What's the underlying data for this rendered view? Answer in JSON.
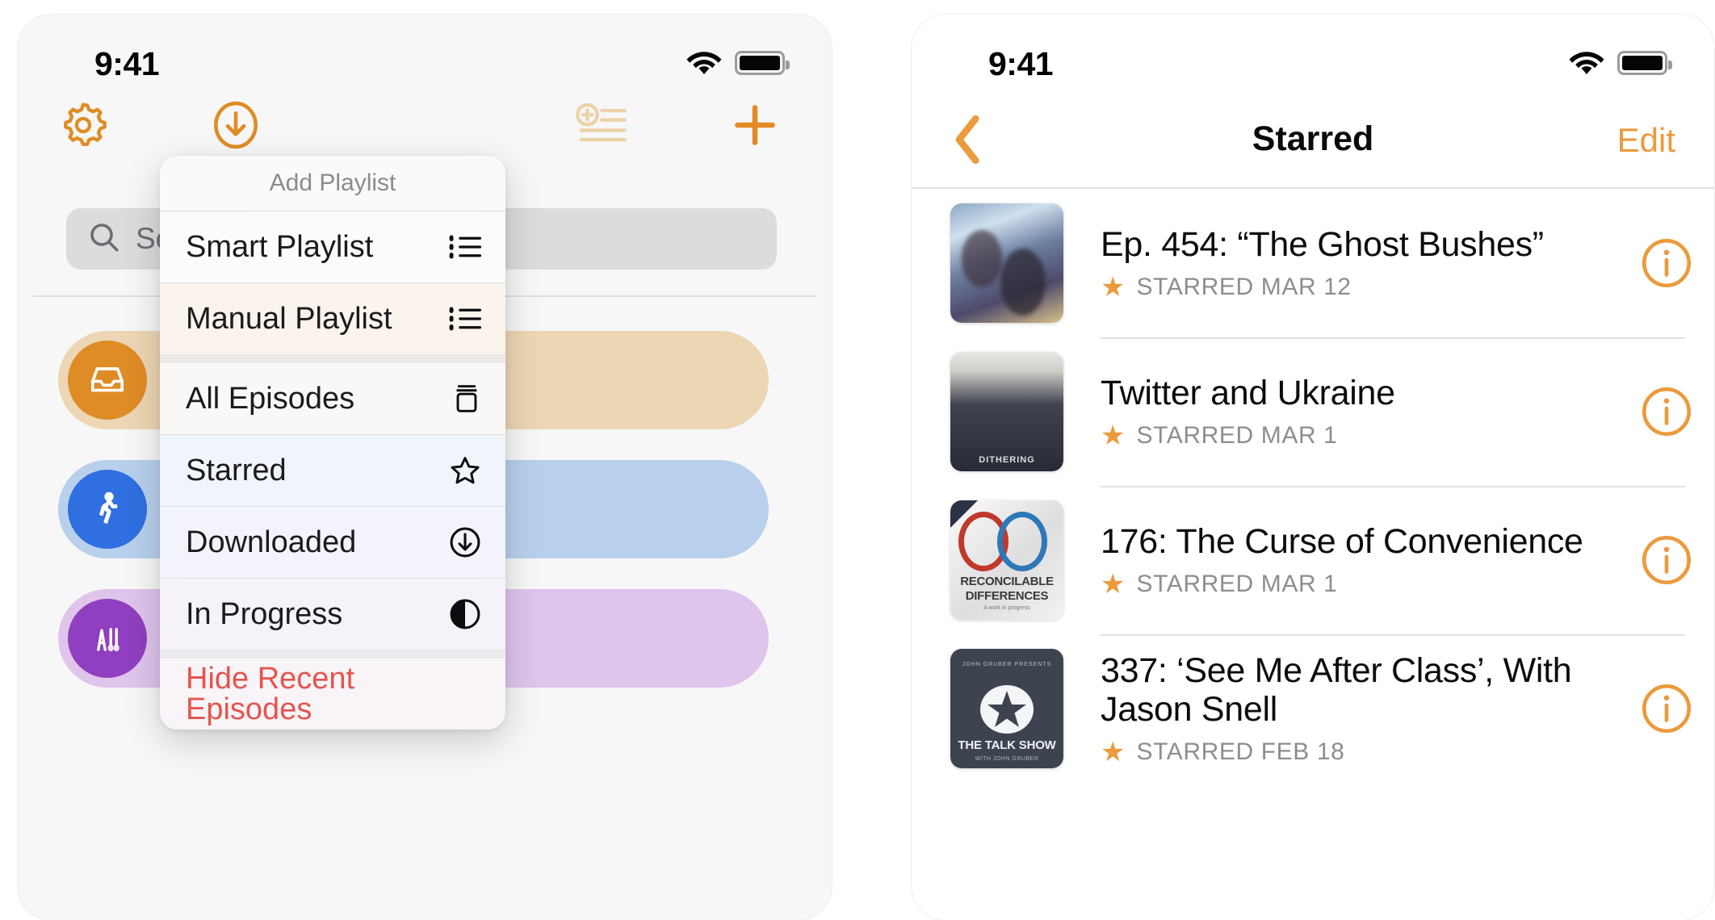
{
  "accent_color": "#eb9a3c",
  "destructive_color": "#e4554c",
  "left_phone": {
    "status": {
      "time": "9:41",
      "wifi_icon": "wifi-icon",
      "battery_icon": "battery-full-icon"
    },
    "toolbar": [
      {
        "name": "settings",
        "icon": "gear-icon"
      },
      {
        "name": "downloads",
        "icon": "arrow-down-circle-icon"
      },
      {
        "name": "add-playlist",
        "icon": "playlist-add-icon"
      },
      {
        "name": "add",
        "icon": "plus-icon"
      }
    ],
    "search": {
      "placeholder": "Search",
      "icon": "search-icon"
    },
    "sidebar_pills": [
      {
        "name": "inbox",
        "icon": "inbox-tray-icon",
        "circle_color": "#df8c26",
        "pill_color": "#ecd6b3"
      },
      {
        "name": "walking",
        "icon": "walking-person-icon",
        "circle_color": "#2f6fe0",
        "pill_color": "#b8d0ec"
      },
      {
        "name": "workout",
        "icon": "workout-icon",
        "circle_color": "#8f3fbf",
        "pill_color": "#dfc4ec"
      }
    ],
    "context_menu": {
      "title": "Add Playlist",
      "groups": [
        [
          {
            "label": "Smart Playlist",
            "icon": "list-bullet-icon"
          },
          {
            "label": "Manual Playlist",
            "icon": "list-bullet-icon"
          }
        ],
        [
          {
            "label": "All Episodes",
            "icon": "archivebox-icon"
          },
          {
            "label": "Starred",
            "icon": "star-outline-icon"
          },
          {
            "label": "Downloaded",
            "icon": "arrow-down-circle-icon"
          },
          {
            "label": "In Progress",
            "icon": "half-circle-icon"
          }
        ],
        [
          {
            "label": "Hide Recent Episodes",
            "icon": "",
            "destructive": true
          }
        ]
      ]
    }
  },
  "right_phone": {
    "status": {
      "time": "9:41",
      "wifi_icon": "wifi-icon",
      "battery_icon": "battery-full-icon"
    },
    "nav": {
      "back_icon": "chevron-left-icon",
      "title": "Starred",
      "edit_label": "Edit"
    },
    "episodes": [
      {
        "title": "Ep. 454: “The Ghost Bushes”",
        "starred_label": "STARRED MAR 12",
        "star_icon": "star-filled-icon",
        "info_icon": "info-circle-icon",
        "artwork": "atp"
      },
      {
        "title": "Twitter and Ukraine",
        "starred_label": "STARRED MAR 1",
        "star_icon": "star-filled-icon",
        "info_icon": "info-circle-icon",
        "artwork": "dithering",
        "artwork_text": "DITHERING"
      },
      {
        "title": "176: The Curse of Convenience",
        "starred_label": "STARRED MAR 1",
        "star_icon": "star-filled-icon",
        "info_icon": "info-circle-icon",
        "artwork": "reconcilable",
        "artwork_line1": "RECONCILABLE",
        "artwork_line2": "DIFFERENCES",
        "artwork_line3": "A work in progress"
      },
      {
        "title": "337: ‘See Me After Class’, With Jason Snell",
        "starred_label": "STARRED FEB 18",
        "star_icon": "star-filled-icon",
        "info_icon": "info-circle-icon",
        "artwork": "talkshow",
        "artwork_top": "JOHN GRUBER PRESENTS",
        "artwork_line1": "THE TALK SHOW",
        "artwork_line2": "WITH JOHN GRUBER"
      }
    ]
  }
}
